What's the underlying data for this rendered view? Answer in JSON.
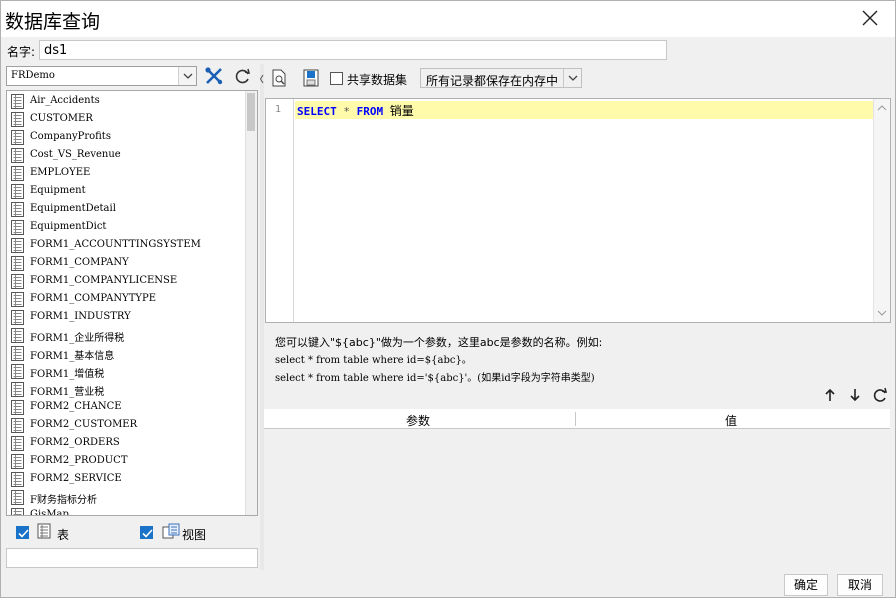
{
  "window": {
    "title": "数据库查询"
  },
  "name_field": {
    "label": "名字:",
    "value": "ds1"
  },
  "left": {
    "database": "FRDemo",
    "tables": [
      "Air_Accidents",
      "CUSTOMER",
      "CompanyProfits",
      "Cost_VS_Revenue",
      "EMPLOYEE",
      "Equipment",
      "EquipmentDetail",
      "EquipmentDict",
      "FORM1_ACCOUNTTINGSYSTEM",
      "FORM1_COMPANY",
      "FORM1_COMPANYLICENSE",
      "FORM1_COMPANYTYPE",
      "FORM1_INDUSTRY",
      "FORM1_企业所得税",
      "FORM1_基本信息",
      "FORM1_增值税",
      "FORM1_营业税",
      "FORM2_CHANCE",
      "FORM2_CUSTOMER",
      "FORM2_ORDERS",
      "FORM2_PRODUCT",
      "FORM2_SERVICE",
      "F财务指标分析",
      "GisMap"
    ],
    "show_tables_label": "表",
    "show_views_label": "视图"
  },
  "right": {
    "share_label": "共享数据集",
    "memory_option": "所有记录都保存在内存中",
    "sql": {
      "line_no": "1",
      "kw_select": "SELECT",
      "star": "*",
      "kw_from": "FROM",
      "table": "销量"
    },
    "hint_line1": "您可以键入\"${abc}\"做为一个参数，这里abc是参数的名称。例如:",
    "hint_line2": "select * from table where id=${abc}。",
    "hint_line3": "select * from table where id='${abc}'。(如果id字段为字符串类型)",
    "param_col": "参数",
    "value_col": "值"
  },
  "footer": {
    "ok": "确定",
    "cancel": "取消"
  },
  "colors": {
    "accent": "#1a73c8",
    "current_line": "#fffbaa",
    "keyword": "#0000ff"
  }
}
